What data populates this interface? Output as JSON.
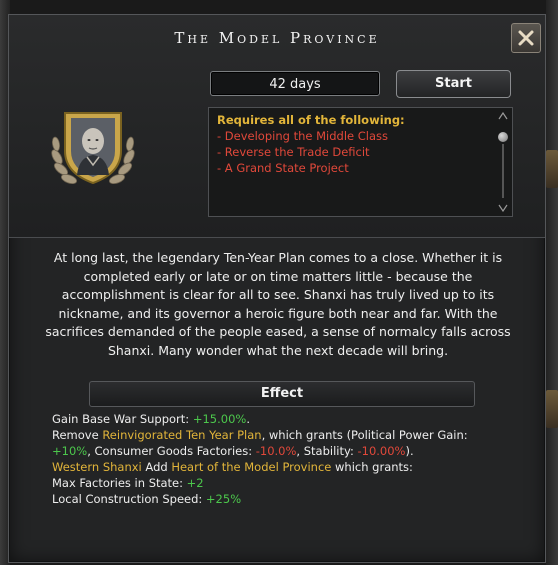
{
  "window": {
    "title": "The Model Province",
    "close_icon": "close-x-icon"
  },
  "focus": {
    "days": "42 days",
    "start_label": "Start",
    "emblem_icon": "laurel-portrait-emblem"
  },
  "requirements": {
    "heading": "Requires all of the following:",
    "items": [
      "- Developing the Middle Class",
      "- Reverse the Trade Deficit",
      "- A Grand State Project"
    ]
  },
  "description": "At long last, the legendary Ten-Year Plan comes to a close. Whether it is completed early or late or on time matters little - because the accomplishment is clear for all to see. Shanxi has truly lived up to its nickname, and its governor a heroic figure both near and far. With the sacrifices demanded of the people eased, a sense of normalcy falls across Shanxi. Many wonder what the next decade will bring.",
  "effect": {
    "heading": "Effect",
    "line1": {
      "label": "Gain Base War Support: ",
      "value": "+15.00%",
      "tail": "."
    },
    "line2": {
      "a": "Remove ",
      "spirit": "Reinvigorated Ten Year Plan",
      "b": ", which grants (Political Power Gain:"
    },
    "line3": {
      "pp": "+10%",
      "a": ", Consumer Goods Factories: ",
      "cgf": "-10.0%",
      "b": ", Stability: ",
      "stab": "-10.00%",
      "c": ")."
    },
    "line4": {
      "state": "Western Shanxi",
      "a": " Add ",
      "modifier": "Heart of the Model Province",
      "b": " which grants:"
    },
    "line5": {
      "label": "Max Factories in State: ",
      "value": "+2"
    },
    "line6": {
      "label": "Local Construction Speed: ",
      "value": "+25%"
    }
  },
  "colors": {
    "positive": "#4cc74c",
    "negative": "#e0483a",
    "highlight": "#e2b53a"
  }
}
